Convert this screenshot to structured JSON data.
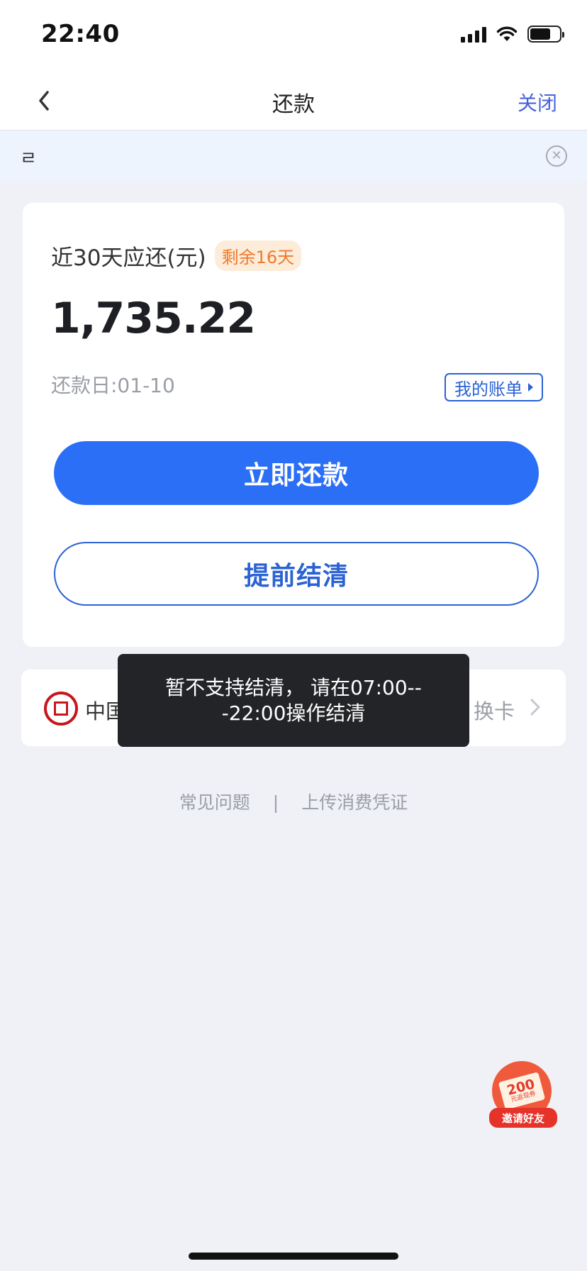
{
  "status_bar": {
    "time": "22:40",
    "icons": [
      "cellular-signal-icon",
      "wifi-icon",
      "battery-icon"
    ]
  },
  "nav": {
    "back_icon": "chevron-left-icon",
    "title": "还款",
    "close_label": "关闭"
  },
  "notice": {
    "text": "ㄹ",
    "close_icon": "circle-close-icon"
  },
  "repayment": {
    "label": "近30天应还(元)",
    "days_badge": "剩余16天",
    "amount": "1,735.22",
    "due_date": "还款日:01-10",
    "bill_button": "我的账单",
    "pay_button": "立即还款",
    "settle_button": "提前结清"
  },
  "bank": {
    "logo_icon": "icbc-logo-icon",
    "name": "中国",
    "change_label": "换卡",
    "chevron_icon": "chevron-right-icon"
  },
  "toast": {
    "line1": "暂不支持结清， 请在07:00--",
    "line2": "-22:00操作结清"
  },
  "footer": {
    "faq": "常见问题",
    "separator": "|",
    "upload": "上传消费凭证"
  },
  "invite": {
    "amount": "200",
    "unit": "元",
    "sub": "返现券",
    "label": "邀请好友"
  },
  "colors": {
    "primary": "#2b6ff7",
    "accent_orange": "#ee7a2e",
    "close_link": "#4a63d8",
    "background": "#eff1f6"
  }
}
